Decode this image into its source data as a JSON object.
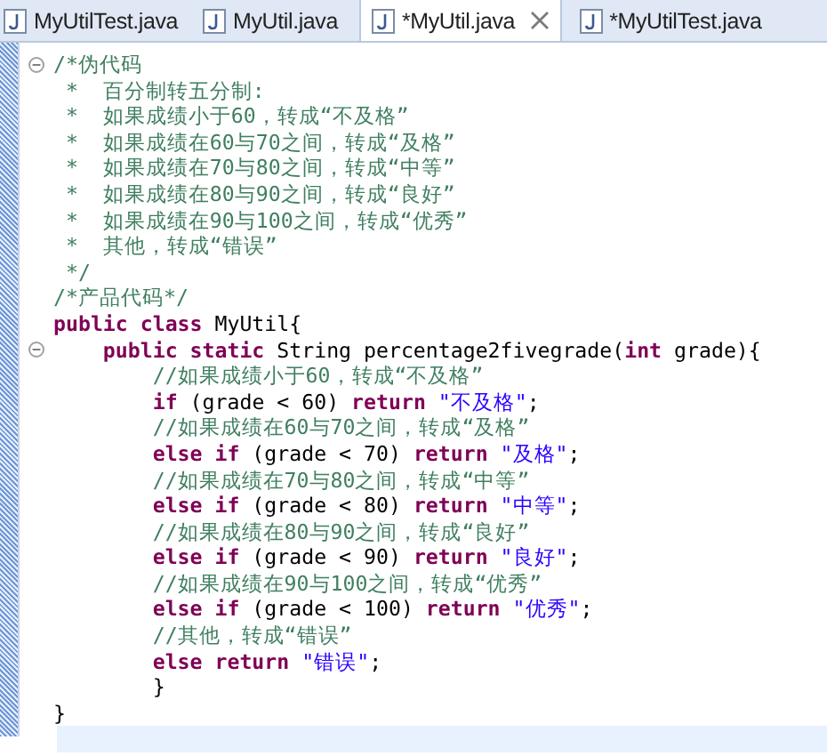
{
  "tabs": [
    {
      "label": "MyUtilTest.java",
      "selected": false
    },
    {
      "label": "MyUtil.java",
      "selected": false
    },
    {
      "label": "*MyUtil.java",
      "selected": true
    },
    {
      "label": "*MyUtilTest.java",
      "selected": false
    }
  ],
  "lines": [
    {
      "fold": true,
      "current": false,
      "tokens": [
        {
          "kind": "comment",
          "text": "/*伪代码"
        }
      ]
    },
    {
      "fold": false,
      "current": false,
      "tokens": [
        {
          "kind": "comment",
          "text": " *  百分制转五分制:"
        }
      ]
    },
    {
      "fold": false,
      "current": false,
      "tokens": [
        {
          "kind": "comment",
          "text": " *  如果成绩小于60，转成“不及格”"
        }
      ]
    },
    {
      "fold": false,
      "current": false,
      "tokens": [
        {
          "kind": "comment",
          "text": " *  如果成绩在60与70之间，转成“及格”"
        }
      ]
    },
    {
      "fold": false,
      "current": false,
      "tokens": [
        {
          "kind": "comment",
          "text": " *  如果成绩在70与80之间，转成“中等”"
        }
      ]
    },
    {
      "fold": false,
      "current": false,
      "tokens": [
        {
          "kind": "comment",
          "text": " *  如果成绩在80与90之间，转成“良好”"
        }
      ]
    },
    {
      "fold": false,
      "current": false,
      "tokens": [
        {
          "kind": "comment",
          "text": " *  如果成绩在90与100之间，转成“优秀”"
        }
      ]
    },
    {
      "fold": false,
      "current": false,
      "tokens": [
        {
          "kind": "comment",
          "text": " *  其他，转成“错误”"
        }
      ]
    },
    {
      "fold": false,
      "current": false,
      "tokens": [
        {
          "kind": "comment",
          "text": " */"
        }
      ]
    },
    {
      "fold": false,
      "current": false,
      "tokens": [
        {
          "kind": "comment",
          "text": "/*产品代码*/"
        }
      ]
    },
    {
      "fold": false,
      "current": false,
      "tokens": [
        {
          "kind": "keyword",
          "text": "public class"
        },
        {
          "kind": "plain",
          "text": " MyUtil{"
        }
      ]
    },
    {
      "fold": true,
      "current": false,
      "tokens": [
        {
          "kind": "keyword",
          "text": "    public static"
        },
        {
          "kind": "plain",
          "text": " String percentage2fivegrade("
        },
        {
          "kind": "keyword",
          "text": "int"
        },
        {
          "kind": "plain",
          "text": " grade){"
        }
      ]
    },
    {
      "fold": false,
      "current": false,
      "tokens": [
        {
          "kind": "comment",
          "text": "        //如果成绩小于60，转成“不及格”"
        }
      ]
    },
    {
      "fold": false,
      "current": false,
      "tokens": [
        {
          "kind": "keyword",
          "text": "        if"
        },
        {
          "kind": "plain",
          "text": " (grade < 60) "
        },
        {
          "kind": "keyword",
          "text": "return"
        },
        {
          "kind": "string",
          "text": " \"不及格\""
        },
        {
          "kind": "plain",
          "text": ";"
        }
      ]
    },
    {
      "fold": false,
      "current": false,
      "tokens": [
        {
          "kind": "comment",
          "text": "        //如果成绩在60与70之间，转成“及格”"
        }
      ]
    },
    {
      "fold": false,
      "current": false,
      "tokens": [
        {
          "kind": "keyword",
          "text": "        else if"
        },
        {
          "kind": "plain",
          "text": " (grade < 70) "
        },
        {
          "kind": "keyword",
          "text": "return"
        },
        {
          "kind": "string",
          "text": " \"及格\""
        },
        {
          "kind": "plain",
          "text": ";"
        }
      ]
    },
    {
      "fold": false,
      "current": false,
      "tokens": [
        {
          "kind": "comment",
          "text": "        //如果成绩在70与80之间，转成“中等”"
        }
      ]
    },
    {
      "fold": false,
      "current": false,
      "tokens": [
        {
          "kind": "keyword",
          "text": "        else if"
        },
        {
          "kind": "plain",
          "text": " (grade < 80) "
        },
        {
          "kind": "keyword",
          "text": "return"
        },
        {
          "kind": "string",
          "text": " \"中等\""
        },
        {
          "kind": "plain",
          "text": ";"
        }
      ]
    },
    {
      "fold": false,
      "current": false,
      "tokens": [
        {
          "kind": "comment",
          "text": "        //如果成绩在80与90之间，转成“良好”"
        }
      ]
    },
    {
      "fold": false,
      "current": false,
      "tokens": [
        {
          "kind": "keyword",
          "text": "        else if"
        },
        {
          "kind": "plain",
          "text": " (grade < 90) "
        },
        {
          "kind": "keyword",
          "text": "return"
        },
        {
          "kind": "string",
          "text": " \"良好\""
        },
        {
          "kind": "plain",
          "text": ";"
        }
      ]
    },
    {
      "fold": false,
      "current": false,
      "tokens": [
        {
          "kind": "comment",
          "text": "        //如果成绩在90与100之间，转成“优秀”"
        }
      ]
    },
    {
      "fold": false,
      "current": false,
      "tokens": [
        {
          "kind": "keyword",
          "text": "        else if"
        },
        {
          "kind": "plain",
          "text": " (grade < 100) "
        },
        {
          "kind": "keyword",
          "text": "return"
        },
        {
          "kind": "string",
          "text": " \"优秀\""
        },
        {
          "kind": "plain",
          "text": ";"
        }
      ]
    },
    {
      "fold": false,
      "current": false,
      "tokens": [
        {
          "kind": "comment",
          "text": "        //其他，转成“错误”"
        }
      ]
    },
    {
      "fold": false,
      "current": false,
      "tokens": [
        {
          "kind": "keyword",
          "text": "        else return"
        },
        {
          "kind": "string",
          "text": " \"错误\""
        },
        {
          "kind": "plain",
          "text": ";"
        }
      ]
    },
    {
      "fold": false,
      "current": false,
      "tokens": [
        {
          "kind": "plain",
          "text": "        }"
        }
      ]
    },
    {
      "fold": false,
      "current": false,
      "tokens": [
        {
          "kind": "plain",
          "text": "}"
        }
      ]
    },
    {
      "fold": false,
      "current": true
    }
  ]
}
